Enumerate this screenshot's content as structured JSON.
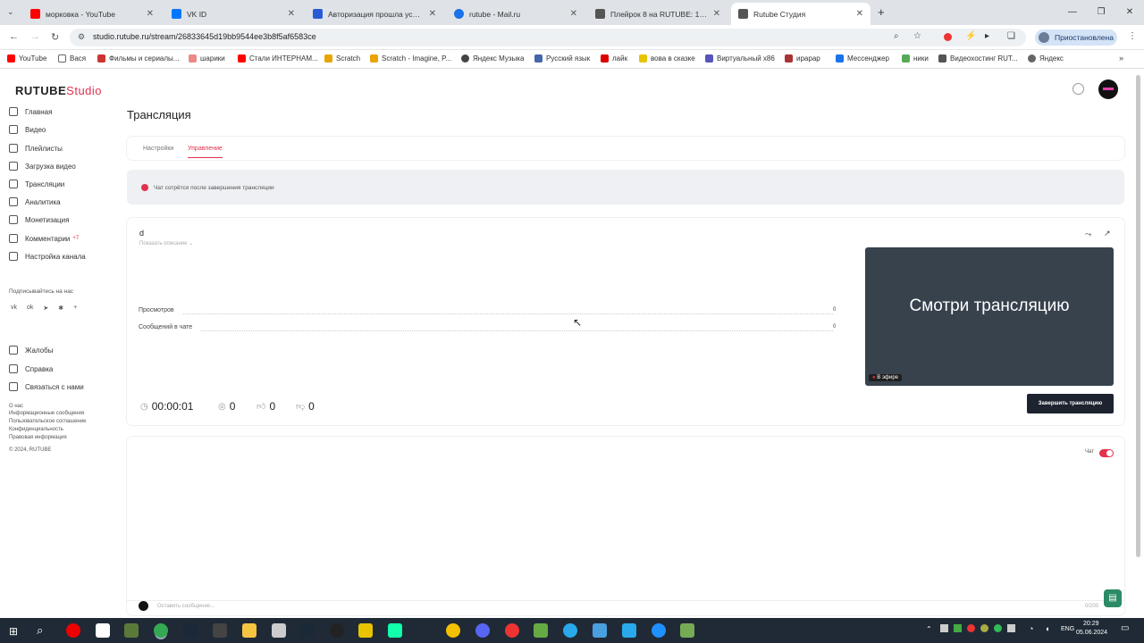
{
  "browser": {
    "tabs": [
      {
        "label": "морковка - YouTube",
        "color": "#ff0000"
      },
      {
        "label": "VK ID",
        "color": "#0077ff"
      },
      {
        "label": "Авторизация прошла успешно",
        "color": "#2a5bd7"
      },
      {
        "label": "rutube - Mail.ru",
        "color": "#1a73e8"
      },
      {
        "label": "Плейрок 8 на RUTUBE: 101 вид",
        "color": "#555555"
      },
      {
        "label": "Rutube Студия",
        "color": "#555555"
      }
    ],
    "address": "studio.rutube.ru/stream/26833645d19bb9544ee3b8f5af6583ce",
    "profile_label": "Приостановлена",
    "bookmarks": [
      "YouTube",
      "Вася",
      "Фильмы и сериалы...",
      "шарики",
      "Стали ИНТЕРНАМ...",
      "Scratch",
      "Scratch - Imagine, P...",
      "Яндекс Музыка",
      "Русский язык",
      "лайк",
      "вова в сказке",
      "Виртуальный x86",
      "ирарар",
      "Мессенджер",
      "ники",
      "Видеохостинг RUT...",
      "Яндекс"
    ]
  },
  "app": {
    "logo_main": "RUTUBE",
    "logo_sub": "Studio",
    "accent": "#e3314e",
    "sidebar": {
      "items": [
        "Главная",
        "Видео",
        "Плейлисты",
        "Загрузка видео",
        "Трансляции",
        "Аналитика",
        "Монетизация",
        "Комментарии",
        "Настройка канала"
      ],
      "comments_badge": "+7",
      "subscribe_title": "Подписывайтесь на нас",
      "help_items": [
        "Жалобы",
        "Справка",
        "Связаться с нами"
      ],
      "footer_links": [
        "О нас",
        "Информационные сообщения",
        "Пользовательское соглашение",
        "Конфиденциальность",
        "Правовая информация"
      ],
      "copyright": "© 2024, RUTUBE"
    },
    "page_title": "Трансляция",
    "tabs": [
      "Настройки",
      "Управление"
    ],
    "notice": "Чат сотрётся после завершения трансляции",
    "stream": {
      "title": "d",
      "show_description": "Показать описание ⌄",
      "views_label": "Просмотров",
      "views_value": "0",
      "chat_label": "Сообщений в чате",
      "chat_value": "0",
      "duration": "00:00:01",
      "viewers": "0",
      "likes": "0",
      "dislikes": "0",
      "preview_text": "Смотри трансляцию",
      "live_badge": "В эфире",
      "end_button": "Завершить трансляцию"
    },
    "chat": {
      "toggle_label": "Чат",
      "input_placeholder": "Оставить сообщение...",
      "char_count": "0/200"
    }
  },
  "taskbar": {
    "lang": "ENG",
    "time": "20:29",
    "date": "05.06.2024"
  }
}
